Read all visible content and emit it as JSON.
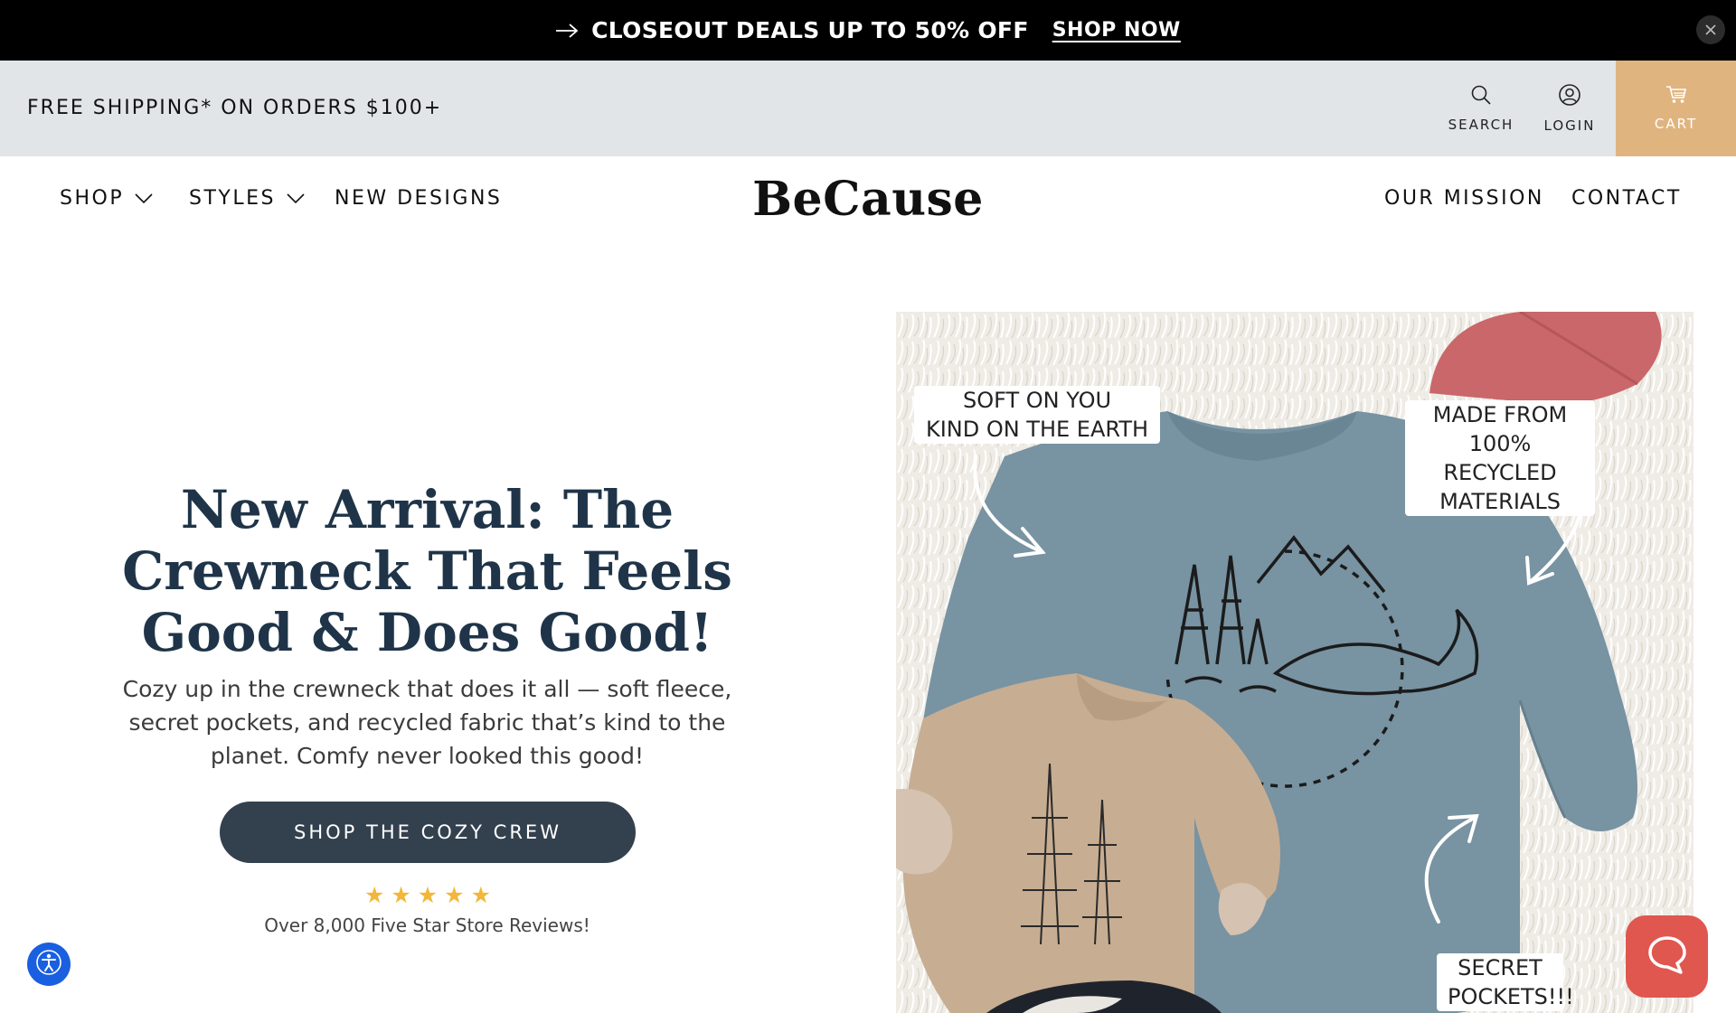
{
  "announcement": {
    "text": "CLOSEOUT DEALS UP TO 50% OFF",
    "link": "SHOP NOW",
    "arrow_icon": "arrow-right-icon",
    "close_icon": "close-icon"
  },
  "utility": {
    "shipping": "FREE SHIPPING* ON ORDERS $100+",
    "search_label": "SEARCH",
    "login_label": "LOGIN",
    "cart_label": "CART",
    "cart_color": "#e0b47f"
  },
  "nav": {
    "logo": "BeCause",
    "left": [
      "SHOP",
      "STYLES",
      "NEW DESIGNS"
    ],
    "right": [
      "OUR MISSION",
      "CONTACT"
    ]
  },
  "hero": {
    "title": "New Arrival: The Crewneck That Feels Good & Does Good!",
    "subtitle": "Cozy up in the crewneck that does it all — soft fleece, secret pockets, and recycled fabric that’s kind to the planet. Comfy never looked this good!",
    "cta": "SHOP THE COZY CREW",
    "rating_stars": 5,
    "reviews": "Over 8,000 Five Star Store Reviews!",
    "title_color": "#1f3448",
    "cta_color": "#33404e",
    "star_color": "#f2b73a"
  },
  "image": {
    "callouts": {
      "soft_line1": "SOFT ON YOU",
      "soft_line2": "KIND ON THE EARTH",
      "made_line1": "MADE FROM",
      "made_line2": "100% RECYCLED",
      "made_line3": "MATERIALS",
      "secret_line1": "SECRET",
      "secret_line2": "POCKETS!!!"
    }
  },
  "widgets": {
    "accessibility_icon": "accessibility-icon",
    "chat_icon": "chat-bubble-icon",
    "accessibility_color": "#1a5fe0",
    "chat_color": "#e0574f"
  }
}
